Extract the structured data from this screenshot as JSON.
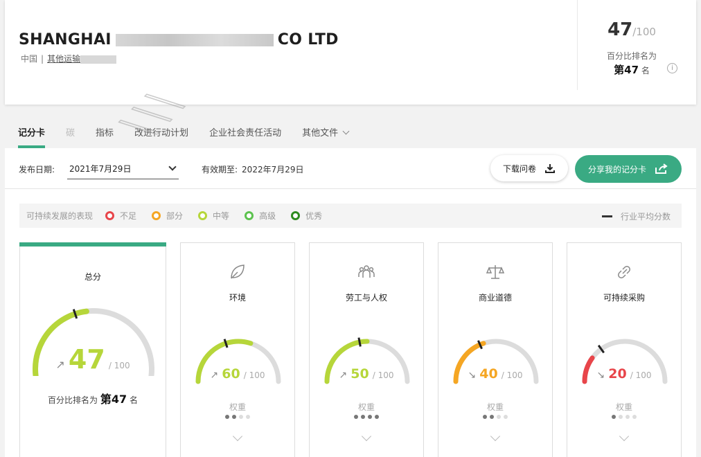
{
  "header": {
    "company_prefix": "SHANGHAI",
    "company_suffix": "CO LTD",
    "country": "中国",
    "separator": "|",
    "industry": "其他运输",
    "score": "47",
    "score_den": "/100",
    "pct_label": "百分比排名为",
    "rank_prefix": "第",
    "rank": "47",
    "rank_suffix": "名",
    "info_icon": "i"
  },
  "tabs": [
    {
      "label": "记分卡"
    },
    {
      "label": "碳"
    },
    {
      "label": "指标"
    },
    {
      "label": "改进行动计划"
    },
    {
      "label": "企业社会责任活动"
    },
    {
      "label": "其他文件"
    }
  ],
  "toolbar": {
    "pub_label": "发布日期:",
    "pub_value": "2021年7月29日",
    "valid_label": "有效期至:",
    "valid_value": "2022年7月29日",
    "download_label": "下载问卷",
    "share_label": "分享我的记分卡"
  },
  "legend": {
    "title": "可持续发展的表现",
    "levels": [
      {
        "label": "不足",
        "color": "#e8454a"
      },
      {
        "label": "部分",
        "color": "#f5a623"
      },
      {
        "label": "中等",
        "color": "#b6d63a"
      },
      {
        "label": "高级",
        "color": "#5cc24e"
      },
      {
        "label": "优秀",
        "color": "#2e8b1f"
      }
    ],
    "avg_label": "行业平均分数"
  },
  "cards": {
    "total": {
      "title": "总分",
      "score": "47",
      "den": "/ 100",
      "arrow": "↗",
      "color": "#b6d63a",
      "fraction": 0.47,
      "avg_fraction": 0.42,
      "rank_prefix": "百分比排名为",
      "rank_mark": "第",
      "rank": "47",
      "rank_suffix": "名"
    },
    "items": [
      {
        "key": "env",
        "title": "环境",
        "icon": "leaf-icon",
        "score": "60",
        "den": "/ 100",
        "arrow": "↗",
        "color": "#b6d63a",
        "fraction": 0.6,
        "avg_fraction": 0.4,
        "weight": "权重",
        "dots": [
          1,
          1,
          0,
          0
        ]
      },
      {
        "key": "labor",
        "title": "劳工与人权",
        "icon": "people-icon",
        "score": "50",
        "den": "/ 100",
        "arrow": "↗",
        "color": "#b6d63a",
        "fraction": 0.5,
        "avg_fraction": 0.44,
        "weight": "权重",
        "dots": [
          1,
          1,
          1,
          1
        ]
      },
      {
        "key": "ethics",
        "title": "商业道德",
        "icon": "scales-icon",
        "score": "40",
        "den": "/ 100",
        "arrow": "↘",
        "color": "#f5a623",
        "fraction": 0.4,
        "avg_fraction": 0.37,
        "weight": "权重",
        "dots": [
          1,
          1,
          0,
          0
        ]
      },
      {
        "key": "proc",
        "title": "可持续采购",
        "icon": "link-icon",
        "score": "20",
        "den": "/ 100",
        "arrow": "↘",
        "color": "#e8454a",
        "fraction": 0.2,
        "avg_fraction": 0.3,
        "weight": "权重",
        "dots": [
          1,
          0,
          0,
          0
        ]
      }
    ]
  }
}
